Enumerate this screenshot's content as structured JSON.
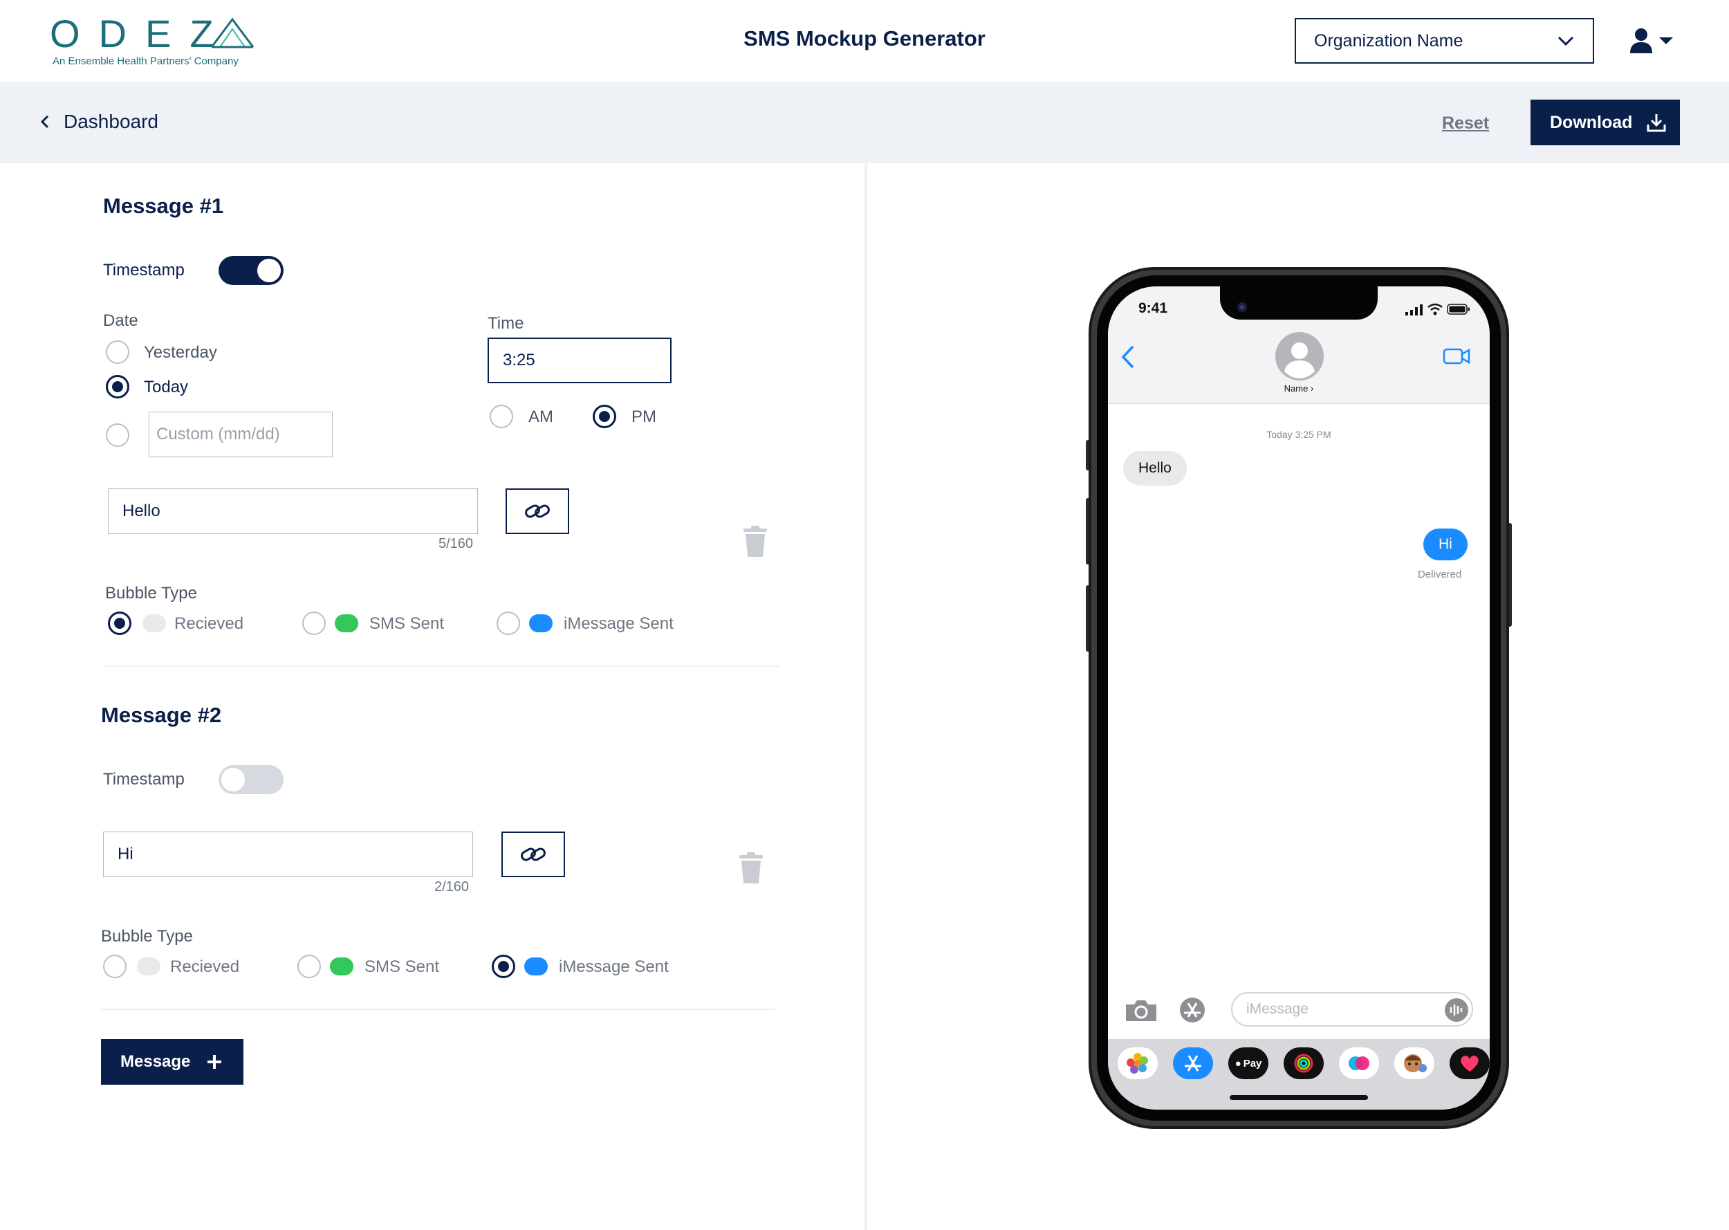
{
  "header": {
    "logo_word": "ODEZ",
    "logo_sub": "An Ensemble Health Partners' Company",
    "title": "SMS Mockup Generator",
    "org_select": "Organization Name"
  },
  "toolbar": {
    "back_label": "Dashboard",
    "reset_label": "Reset",
    "download_label": "Download"
  },
  "message1": {
    "title": "Message #1",
    "timestamp_label": "Timestamp",
    "timestamp_on": true,
    "date_label": "Date",
    "date_options": [
      "Yesterday",
      "Today"
    ],
    "date_selected": "Today",
    "custom_placeholder": "Custom (mm/dd)",
    "time_label": "Time",
    "time_value": "3:25",
    "am_label": "AM",
    "pm_label": "PM",
    "meridiem_selected": "PM",
    "text": "Hello",
    "counter": "5/160",
    "bubble_type_label": "Bubble Type",
    "bubble_options": [
      "Recieved",
      "SMS Sent",
      "iMessage Sent"
    ],
    "bubble_selected": "Recieved"
  },
  "message2": {
    "title": "Message #2",
    "timestamp_label": "Timestamp",
    "timestamp_on": false,
    "text": "Hi",
    "counter": "2/160",
    "bubble_type_label": "Bubble Type",
    "bubble_options": [
      "Recieved",
      "SMS Sent",
      "iMessage Sent"
    ],
    "bubble_selected": "iMessage Sent"
  },
  "add_message_label": "Message",
  "colors": {
    "navy": "#0b1f4b",
    "teal": "#1c6e78",
    "received": "#e9e9eb",
    "sms_green": "#34c759",
    "imessage_blue": "#1a8cff"
  },
  "phone": {
    "clock": "9:41",
    "contact_name": "Name",
    "timestamp": "Today 3:25 PM",
    "received_text": "Hello",
    "sent_text": "Hi",
    "delivered": "Delivered",
    "compose_placeholder": "iMessage",
    "apple_pay": "Pay"
  }
}
